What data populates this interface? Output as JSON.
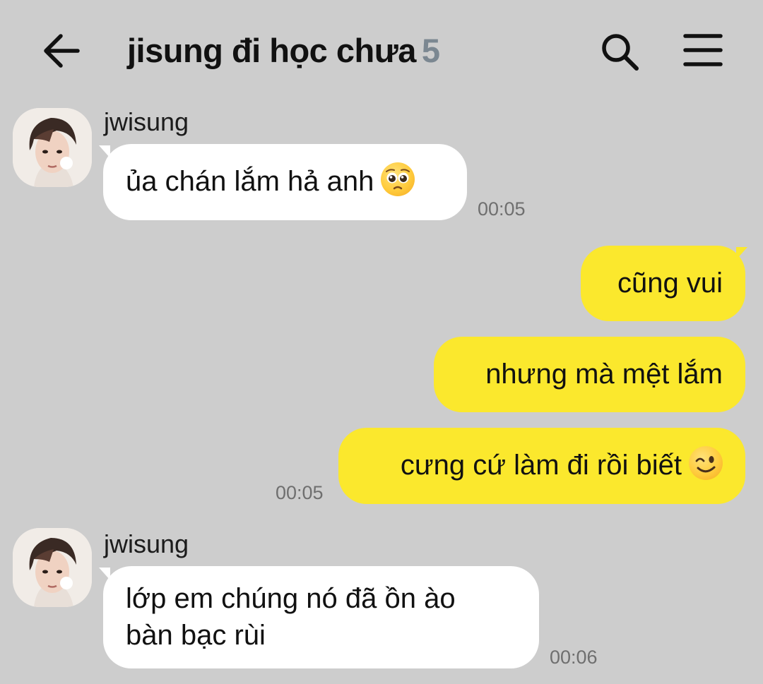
{
  "header": {
    "title": "jisung đi học chưa",
    "member_count": "5"
  },
  "icons": {
    "back": "arrow-left-icon",
    "search": "search-icon",
    "menu": "hamburger-menu-icon"
  },
  "messages": [
    {
      "sender": "jwisung",
      "direction": "in",
      "text": "ủa chán lắm hả anh",
      "emoji": "pleading-face",
      "time": "00:05"
    },
    {
      "direction": "out",
      "text": "cũng vui"
    },
    {
      "direction": "out",
      "text": "nhưng mà mệt lắm"
    },
    {
      "direction": "out",
      "text": "cưng cứ làm đi rồi biết",
      "emoji": "winking-face",
      "time": "00:05"
    },
    {
      "sender": "jwisung",
      "direction": "in",
      "lines": [
        "lớp em chúng nó đã ồn ào",
        "bàn bạc rùi"
      ],
      "time": "00:06"
    }
  ],
  "colors": {
    "background": "#cdcdcd",
    "incoming_bubble": "#ffffff",
    "outgoing_bubble": "#fbe82d",
    "member_count": "#7b8791",
    "timestamp": "#6f6f6f"
  }
}
